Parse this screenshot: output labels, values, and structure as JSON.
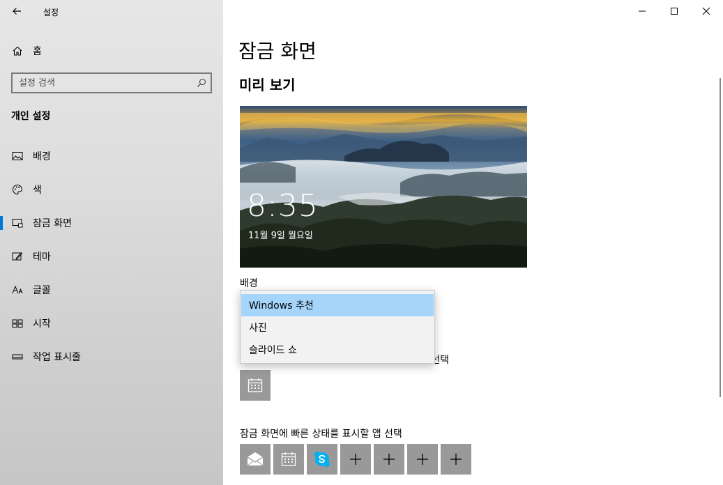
{
  "app": {
    "title": "설정"
  },
  "sidebar": {
    "home_label": "홈",
    "search_placeholder": "설정 검색",
    "section_heading": "개인 설정",
    "items": [
      {
        "label": "배경",
        "icon": "image-icon"
      },
      {
        "label": "색",
        "icon": "palette-icon"
      },
      {
        "label": "잠금 화면",
        "icon": "lock-screen-icon",
        "active": true
      },
      {
        "label": "테마",
        "icon": "theme-icon"
      },
      {
        "label": "글꼴",
        "icon": "font-icon"
      },
      {
        "label": "시작",
        "icon": "start-icon"
      },
      {
        "label": "작업 표시줄",
        "icon": "taskbar-icon"
      }
    ]
  },
  "main": {
    "page_title": "잠금 화면",
    "preview_heading": "미리 보기",
    "preview": {
      "time": "8:35",
      "date": "11월 9일 월요일"
    },
    "background_label": "배경",
    "background_dropdown": {
      "selected": "Windows 추천",
      "options": [
        "Windows 추천",
        "사진",
        "슬라이드 쇼"
      ]
    },
    "detail_status_label_visible": "선택",
    "quick_status_label": "잠금 화면에 빠른 상태를 표시할 앱 선택",
    "quick_status_apps": [
      "mail-icon",
      "calendar-icon",
      "skype-icon",
      "plus-icon",
      "plus-icon",
      "plus-icon",
      "plus-icon"
    ]
  },
  "colors": {
    "accent": "#0078d7",
    "dropdown_selected": "#a5d5fb",
    "tile_bg": "#999999"
  }
}
